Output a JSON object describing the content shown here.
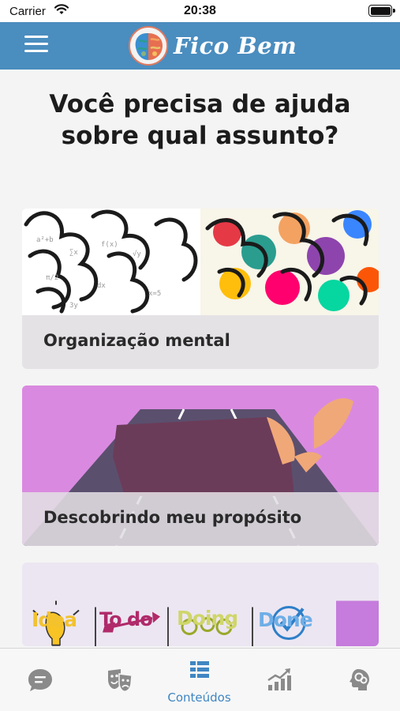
{
  "status_bar": {
    "carrier": "Carrier",
    "time": "20:38"
  },
  "header": {
    "app_name": "Fico Bem"
  },
  "page_title": "Você precisa de ajuda sobre qual assunto?",
  "cards": [
    {
      "label": "Organização mental"
    },
    {
      "label": "Descobrindo meu propósito"
    },
    {
      "board_columns": [
        "Idea",
        "To do",
        "Doing",
        "Done"
      ]
    }
  ],
  "tab_bar": {
    "tabs": [
      {
        "icon": "chat-bubble-icon",
        "label": ""
      },
      {
        "icon": "theater-masks-icon",
        "label": ""
      },
      {
        "icon": "content-list-icon",
        "label": "Conteúdos",
        "active": true
      },
      {
        "icon": "growth-chart-icon",
        "label": ""
      },
      {
        "icon": "brain-head-icon",
        "label": ""
      }
    ]
  },
  "colors": {
    "header": "#4a8dbf",
    "accent": "#3f86c2",
    "inactive_icon": "#8a8a8a"
  }
}
